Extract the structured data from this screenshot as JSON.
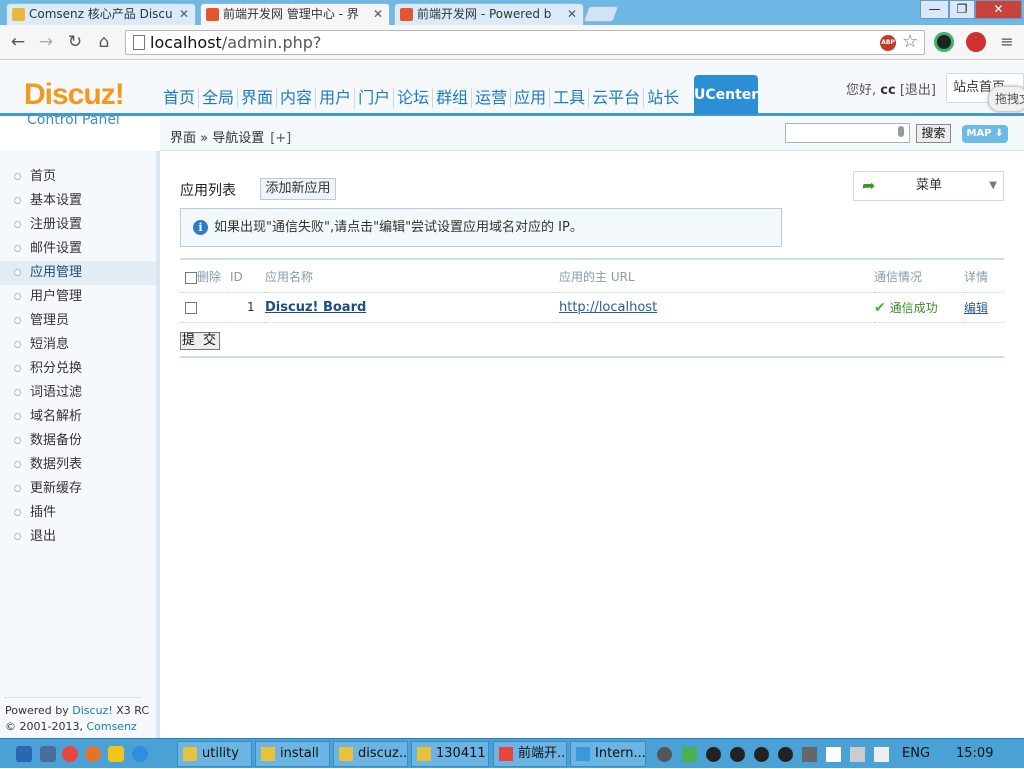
{
  "browser": {
    "tabs": [
      {
        "title": "Comsenz 核心产品 Discu"
      },
      {
        "title": "前端开发网 管理中心 - 界"
      },
      {
        "title": "前端开发网 - Powered b"
      }
    ],
    "url_prefix": "localhost",
    "url_path": "/admin.php?",
    "abp_label": "ABP"
  },
  "header": {
    "logo": "Discuz!",
    "logo_sub": "Control Panel",
    "nav": [
      "首页",
      "全局",
      "界面",
      "内容",
      "用户",
      "门户",
      "论坛",
      "群组",
      "运营",
      "应用",
      "工具",
      "云平台",
      "站长"
    ],
    "active_nav": "UCenter",
    "greeting_prefix": "您好,",
    "username": "cc",
    "logout": "[退出]",
    "site_select": "站点首页",
    "drag_tip": "拖拽文"
  },
  "subheader": {
    "breadcrumb": "界面 » 导航设置",
    "plus": "[+]",
    "search_button": "搜索",
    "map_button": "MAP ⬇"
  },
  "sidebar": {
    "items": [
      "首页",
      "基本设置",
      "注册设置",
      "邮件设置",
      "应用管理",
      "用户管理",
      "管理员",
      "短消息",
      "积分兑换",
      "词语过滤",
      "域名解析",
      "数据备份",
      "数据列表",
      "更新缓存",
      "插件",
      "退出"
    ],
    "active": "应用管理",
    "powered_prefix": "Powered by",
    "powered_product": "Discuz!",
    "powered_version": "X3 RC",
    "copyright_prefix": "© 2001-2013,",
    "copyright_company": "Comsenz Inc."
  },
  "main": {
    "heading": "应用列表",
    "add_button": "添加新应用",
    "menu_button": "菜单",
    "notice": "如果出现\"通信失败\",请点击\"编辑\"尝试设置应用域名对应的 IP。",
    "columns": [
      "删除",
      "ID",
      "应用名称",
      "应用的主 URL",
      "通信情况",
      "详情"
    ],
    "rows": [
      {
        "id": "1",
        "name": "Discuz! Board",
        "url": "http://localhost",
        "status": "通信成功",
        "action": "编辑"
      }
    ],
    "submit": "提 交"
  },
  "taskbar": {
    "tasks": [
      "utility",
      "install",
      "discuz...",
      "130411",
      "前端开...",
      "Intern..."
    ],
    "lang": "ENG",
    "time": "15:09"
  }
}
